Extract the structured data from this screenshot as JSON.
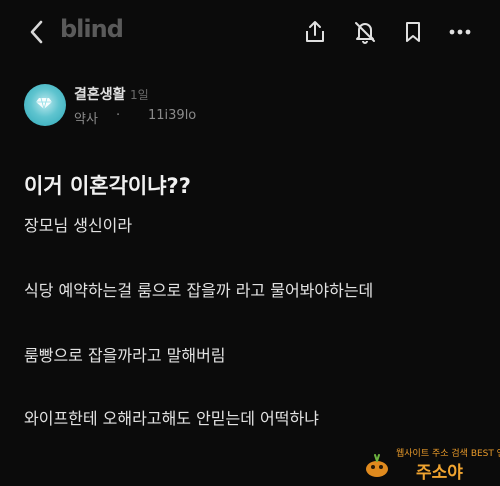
{
  "app": {
    "logo": "blind"
  },
  "toolbar": {
    "back_icon": "chevron-left-icon",
    "share_icon": "share-icon",
    "mute_icon": "bell-off-icon",
    "bookmark_icon": "bookmark-icon",
    "more_icon": "more-horizontal-icon"
  },
  "author": {
    "name": "결혼생활",
    "time_ago": "1일",
    "company": "약사",
    "separator": "·",
    "handle": "11i39lo"
  },
  "post": {
    "title": "이거 이혼각이냐??",
    "paragraphs": [
      "장모님 생신이라",
      "식당 예약하는걸 룸으로 잡을까 라고 물어봐야하는데",
      "룸빵으로 잡을까라고 말해버림",
      "와이프한테 오해라고해도 안믿는데 어떡하냐"
    ]
  },
  "watermark": {
    "line1": "웹사이트 주소 검색 BEST 엔진",
    "line2": "주소야"
  },
  "colors": {
    "background": "#0b0b0b",
    "text": "#e6e6e6",
    "muted": "#8a8a8a",
    "watermark": "#f0a430"
  }
}
